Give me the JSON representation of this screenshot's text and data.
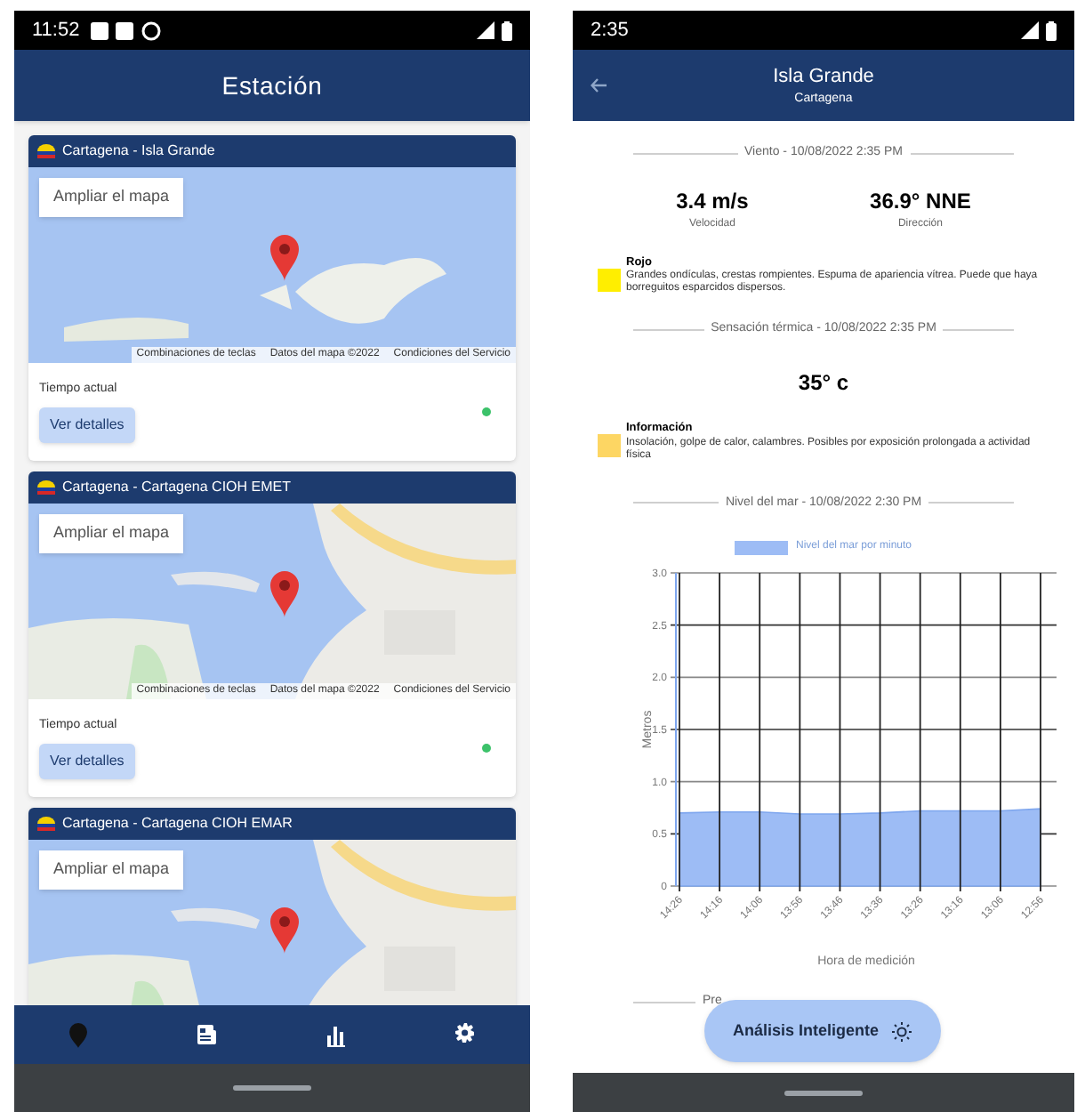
{
  "left_phone": {
    "status_bar": {
      "time": "11:52"
    },
    "header": {
      "title": "Estación"
    },
    "stations": [
      {
        "title": "Cartagena - Isla Grande",
        "map_button": "Ampliar el mapa",
        "map_footer": [
          "Combinaciones de teclas",
          "Datos del mapa ©2022",
          "Condiciones del Servicio"
        ],
        "label": "Tiempo actual",
        "button": "Ver detalles",
        "online": true
      },
      {
        "title": "Cartagena - Cartagena CIOH EMET",
        "map_button": "Ampliar el mapa",
        "map_footer": [
          "Combinaciones de teclas",
          "Datos del mapa ©2022",
          "Condiciones del Servicio"
        ],
        "label": "Tiempo actual",
        "button": "Ver detalles",
        "online": true
      },
      {
        "title": "Cartagena - Cartagena CIOH EMAR",
        "map_button": "Ampliar el mapa"
      }
    ],
    "nav_items": [
      {
        "selected": true
      },
      {
        "selected": false
      },
      {
        "selected": false
      },
      {
        "selected": false
      }
    ]
  },
  "right_phone": {
    "status_bar": {
      "time": "2:35"
    },
    "header": {
      "title": "Isla Grande",
      "subtitle": "Cartagena"
    },
    "wind": {
      "heading": "Viento - 10/08/2022 2:35 PM",
      "speed": "3.4 m/s",
      "speed_label": "Velocidad",
      "direction": "36.9° NNE",
      "direction_label": "Dirección",
      "alert": {
        "title": "Rojo",
        "text": "Grandes ondículas, crestas rompientes. Espuma de apariencia vítrea. Puede que haya borreguitos esparcidos dispersos.",
        "color": "#ffee00"
      }
    },
    "thermal": {
      "heading": "Sensación térmica - 10/08/2022 2:35 PM",
      "value": "35° c",
      "alert": {
        "title": "Información",
        "text": "Insolación, golpe de calor, calambres. Posibles por exposición prolongada a actividad física",
        "color": "#fdd663"
      }
    },
    "sea_level": {
      "heading": "Nivel del mar - 10/08/2022 2:30 PM",
      "chart_data": {
        "type": "area",
        "xlabel": "Hora de medición",
        "ylabel": "Metros",
        "categories": [
          "14:26",
          "14:16",
          "14:06",
          "13:56",
          "13:46",
          "13:36",
          "13:26",
          "13:16",
          "13:06",
          "12:56"
        ],
        "series": [
          {
            "name": "Nivel del mar por minuto",
            "color": "#9dbcf5",
            "values": [
              0.7,
              0.71,
              0.71,
              0.69,
              0.69,
              0.7,
              0.72,
              0.72,
              0.72,
              0.74
            ]
          }
        ],
        "ylim": [
          0,
          3
        ],
        "grid": true,
        "yticks": [
          {
            "value": 0,
            "label": "0"
          },
          {
            "value": 0.5,
            "label": "0.5"
          },
          {
            "value": 1,
            "label": "1.0"
          },
          {
            "value": 1.5,
            "label": "1.5"
          },
          {
            "value": 2,
            "label": "2.0"
          },
          {
            "value": 2.5,
            "label": "2.5"
          },
          {
            "value": 3,
            "label": "3.0"
          }
        ]
      }
    },
    "next_heading": "Pre",
    "fab": {
      "label": "Análisis Inteligente"
    }
  }
}
